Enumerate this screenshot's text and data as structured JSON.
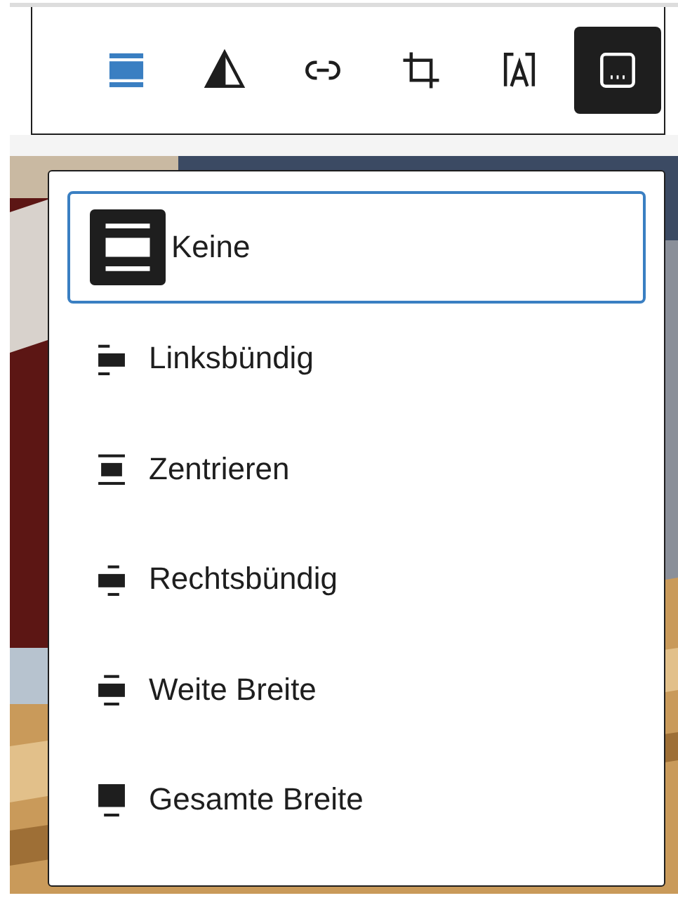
{
  "toolbar": {
    "buttons": [
      {
        "kind": "align",
        "open": true,
        "pressed": false
      },
      {
        "kind": "duotone",
        "open": false,
        "pressed": false
      },
      {
        "kind": "link",
        "open": false,
        "pressed": false
      },
      {
        "kind": "crop",
        "open": false,
        "pressed": false
      },
      {
        "kind": "text",
        "open": false,
        "pressed": false
      },
      {
        "kind": "caption",
        "open": false,
        "pressed": true
      }
    ]
  },
  "align_menu": {
    "items": [
      {
        "kind": "none",
        "label": "Keine",
        "selected": true
      },
      {
        "kind": "left",
        "label": "Linksbündig",
        "selected": false
      },
      {
        "kind": "center",
        "label": "Zentrieren",
        "selected": false
      },
      {
        "kind": "right",
        "label": "Rechtsbündig",
        "selected": false
      },
      {
        "kind": "wide",
        "label": "Weite Breite",
        "selected": false
      },
      {
        "kind": "full",
        "label": "Gesamte Breite",
        "selected": false
      }
    ]
  }
}
